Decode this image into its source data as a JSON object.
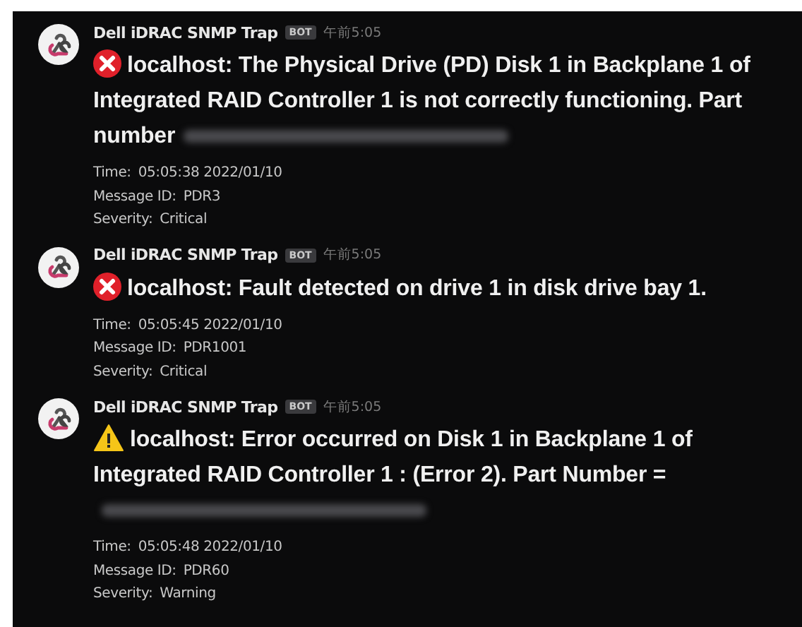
{
  "messages": [
    {
      "sender": "Dell iDRAC SNMP Trap",
      "badge": "BOT",
      "time": "午前5:05",
      "kind": "critical",
      "text": "localhost: The Physical Drive (PD) Disk 1 in Backplane 1 of Integrated RAID Controller 1 is not correctly functioning. Part number",
      "redacted": true,
      "details": [
        {
          "label": "Time:",
          "value": "05:05:38 2022/01/10"
        },
        {
          "label": "Message ID:",
          "value": "PDR3"
        },
        {
          "label": "Severity:",
          "value": "Critical"
        }
      ]
    },
    {
      "sender": "Dell iDRAC SNMP Trap",
      "badge": "BOT",
      "time": "午前5:05",
      "kind": "critical",
      "text": "localhost: Fault detected on drive 1 in disk drive bay 1.",
      "redacted": false,
      "details": [
        {
          "label": "Time:",
          "value": "05:05:45 2022/01/10"
        },
        {
          "label": "Message ID:",
          "value": "PDR1001"
        },
        {
          "label": "Severity:",
          "value": "Critical"
        }
      ]
    },
    {
      "sender": "Dell iDRAC SNMP Trap",
      "badge": "BOT",
      "time": "午前5:05",
      "kind": "warning",
      "text": "localhost: Error occurred on Disk 1 in Backplane 1 of Integrated RAID Controller 1 : (Error 2). Part Number =",
      "redacted": true,
      "details": [
        {
          "label": "Time:",
          "value": "05:05:48 2022/01/10"
        },
        {
          "label": "Message ID:",
          "value": "PDR60"
        },
        {
          "label": "Severity:",
          "value": "Warning"
        }
      ]
    }
  ]
}
